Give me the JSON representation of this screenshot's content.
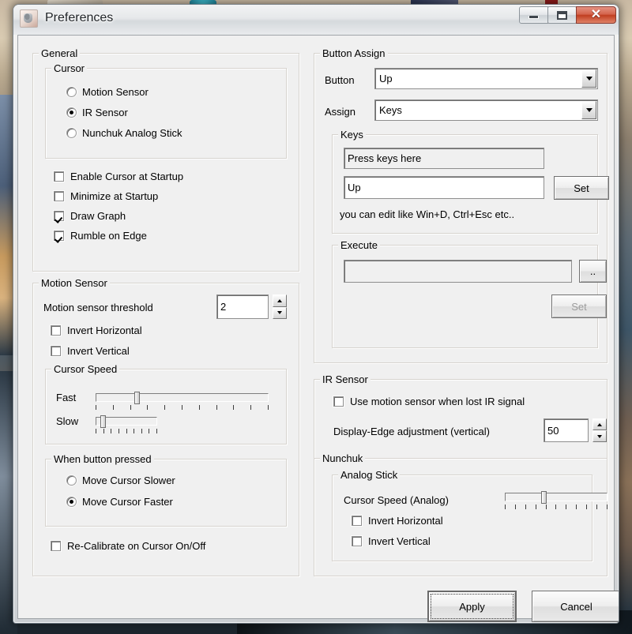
{
  "window": {
    "title": "Preferences",
    "icon": "app-icon",
    "buttons": {
      "minimize": "minimize",
      "maximize": "maximize",
      "close": "close"
    }
  },
  "left": {
    "general": {
      "legend": "General",
      "cursor": {
        "legend": "Cursor",
        "options": [
          {
            "label": "Motion Sensor",
            "selected": false
          },
          {
            "label": "IR Sensor",
            "selected": true
          },
          {
            "label": "Nunchuk Analog Stick",
            "selected": false
          }
        ]
      },
      "checks": [
        {
          "label": "Enable Cursor at Startup",
          "checked": false
        },
        {
          "label": "Minimize at Startup",
          "checked": false
        },
        {
          "label": "Draw Graph",
          "checked": true
        },
        {
          "label": "Rumble on Edge",
          "checked": true
        }
      ]
    },
    "motion_sensor": {
      "legend": "Motion Sensor",
      "threshold_label": "Motion sensor threshold",
      "threshold_value": "2",
      "checks": [
        {
          "label": "Invert Horizontal",
          "checked": false
        },
        {
          "label": "Invert Vertical",
          "checked": false
        }
      ],
      "cursor_speed": {
        "legend": "Cursor Speed",
        "fast_label": "Fast",
        "slow_label": "Slow",
        "fast_percent": 23,
        "slow_percent": 8,
        "fast_ticks": 11,
        "slow_ticks": 9
      },
      "when_pressed": {
        "legend": "When button pressed",
        "options": [
          {
            "label": "Move Cursor Slower",
            "selected": false
          },
          {
            "label": "Move Cursor Faster",
            "selected": true
          }
        ]
      },
      "recalibrate": {
        "label": "Re-Calibrate on Cursor On/Off",
        "checked": false
      }
    }
  },
  "right": {
    "button_assign": {
      "legend": "Button Assign",
      "button_label": "Button",
      "button_value": "Up",
      "assign_label": "Assign",
      "assign_value": "Keys",
      "keys": {
        "legend": "Keys",
        "press_field_value": "Press keys here",
        "edit_field_value": "Up",
        "set_label": "Set",
        "hint": "you can edit like Win+D, Ctrl+Esc etc.."
      },
      "execute": {
        "legend": "Execute",
        "path_value": "",
        "browse_label": "..",
        "set_label": "Set",
        "set_disabled": true
      }
    },
    "ir_sensor": {
      "legend": "IR Sensor",
      "use_motion": {
        "label": "Use motion sensor when lost IR signal",
        "checked": false
      },
      "display_edge_label": "Display-Edge adjustment (vertical)",
      "display_edge_value": "50"
    },
    "nunchuk": {
      "legend": "Nunchuk",
      "analog_stick": {
        "legend": "Analog Stick",
        "speed_label": "Cursor Speed (Analog)",
        "speed_percent": 37,
        "speed_ticks": 11,
        "checks": [
          {
            "label": "Invert Horizontal",
            "checked": false
          },
          {
            "label": "Invert Vertical",
            "checked": false
          }
        ]
      }
    }
  },
  "footer": {
    "apply_label": "Apply",
    "cancel_label": "Cancel"
  }
}
